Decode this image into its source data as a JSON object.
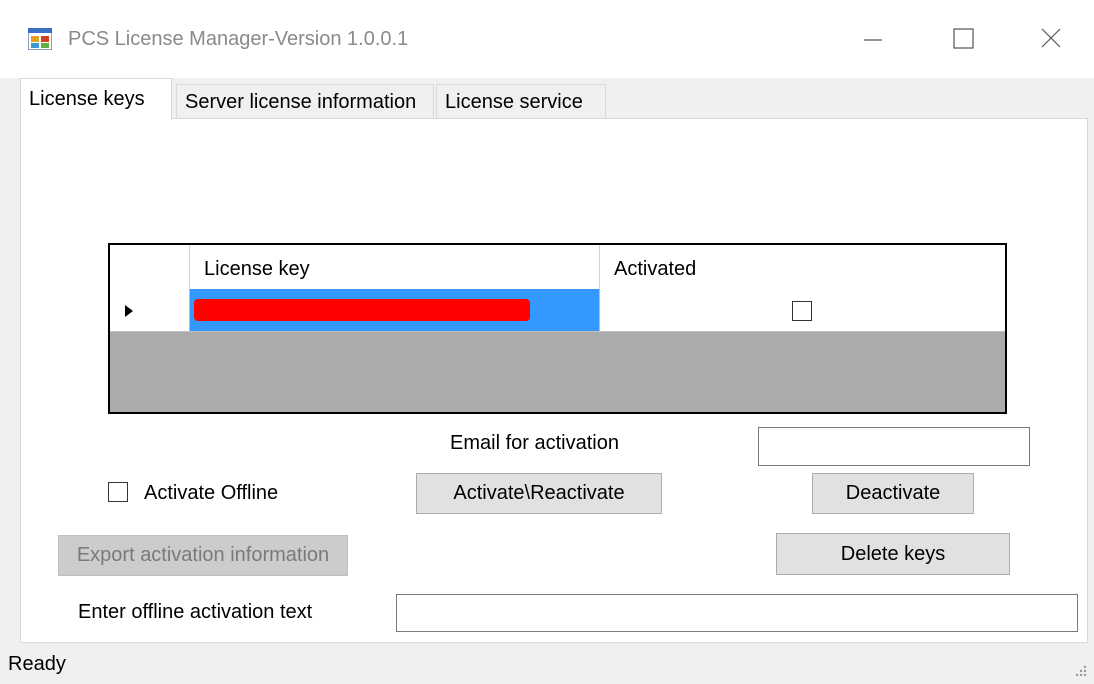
{
  "window": {
    "title": "PCS License Manager-Version 1.0.0.1",
    "icon": "app-window-icon"
  },
  "tabs": [
    {
      "label": "License keys",
      "active": true
    },
    {
      "label": "Server license information",
      "active": false
    },
    {
      "label": "License service",
      "active": false
    }
  ],
  "grid": {
    "columns": [
      "License key",
      "Activated"
    ],
    "rows": [
      {
        "license_key": "",
        "redacted": true,
        "activated": false,
        "selected": true
      }
    ]
  },
  "form": {
    "email_label": "Email for activation",
    "email_value": "",
    "activate_offline_label": "Activate Offline",
    "activate_offline_checked": false,
    "activate_button": "Activate\\Reactivate",
    "deactivate_button": "Deactivate",
    "export_button": "Export activation information",
    "delete_button": "Delete keys",
    "offline_text_label": "Enter offline activation text",
    "offline_text_value": ""
  },
  "status": {
    "text": "Ready"
  },
  "colors": {
    "selection": "#3399ff",
    "redaction": "#ff0000",
    "grid_background": "#ababab"
  }
}
